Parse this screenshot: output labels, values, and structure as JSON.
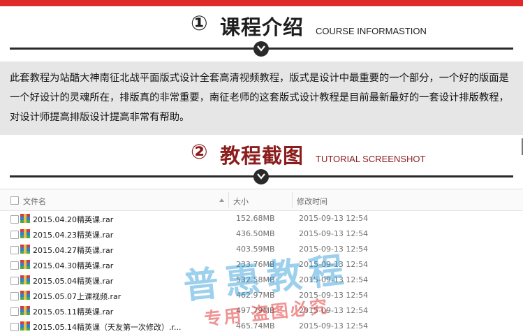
{
  "section1": {
    "number": "①",
    "title": "课程介绍",
    "subtitle": "COURSE  INFORMASTION"
  },
  "description": "此套教程为站酷大神南征北战平面版式设计全套高清视频教程，版式是设计中最重要的一个部分，一个好的版面是一个好设计的灵魂所在，排版真的非常重要，南征老师的这套版式设计教程是目前最新最好的一套设计排版教程，对设计师提高排版设计提高非常有帮助。",
  "section2": {
    "number": "②",
    "title": "教程截图",
    "subtitle": "TUTORIAL SCREENSHOT"
  },
  "explorer": {
    "columns": {
      "name": "文件名",
      "size": "大小",
      "modified": "修改时间"
    },
    "files": [
      {
        "name": "2015.04.20精英课.rar",
        "size": "152.68MB",
        "modified": "2015-09-13 12:54"
      },
      {
        "name": "2015.04.23精英课.rar",
        "size": "436.50MB",
        "modified": "2015-09-13 12:54"
      },
      {
        "name": "2015.04.27精英课.rar",
        "size": "403.59MB",
        "modified": "2015-09-13 12:54"
      },
      {
        "name": "2015.04.30精英课.rar",
        "size": "233.76MB",
        "modified": "2015-09-13 12:54"
      },
      {
        "name": "2015.05.04精英课.rar",
        "size": "532.58MB",
        "modified": "2015-09-13 12:54"
      },
      {
        "name": "2015.05.07上课视频.rar",
        "size": "462.97MB",
        "modified": "2015-09-13 12:54"
      },
      {
        "name": "2015.05.11精英课.rar",
        "size": "497.79MB",
        "modified": "2015-09-13 12:54"
      },
      {
        "name": "2015.05.14精英课（天友第一次修改）.r...",
        "size": "465.74MB",
        "modified": "2015-09-13 12:54"
      }
    ]
  },
  "watermark": {
    "main": "普惠教程",
    "sub": "专用 盗图必究"
  },
  "colors": {
    "top_bar": "#e02a2a",
    "section2_accent": "#8b1d1d",
    "watermark_blue": "#2696d7",
    "watermark_red": "#e12828"
  },
  "icons": {
    "chevron": "chevron-down-icon",
    "file": "rar-archive-icon",
    "sort": "sort-arrow-icon"
  }
}
